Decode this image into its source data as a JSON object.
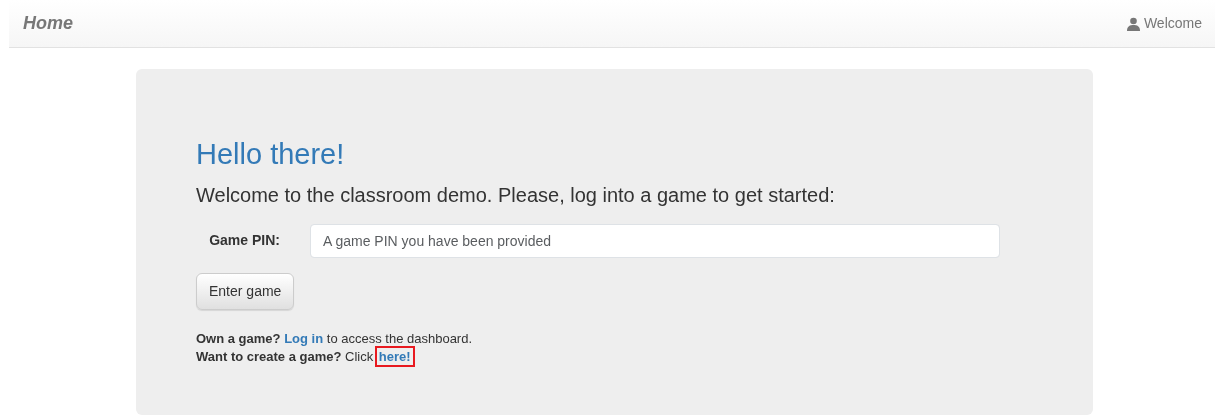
{
  "navbar": {
    "brand": "Home",
    "user_link": "Welcome"
  },
  "hero": {
    "title": "Hello there!",
    "lead": "Welcome to the classroom demo. Please, log into a game to get started:"
  },
  "form": {
    "label": "Game PIN:",
    "placeholder": "A game PIN you have been provided",
    "button": "Enter game"
  },
  "notes": [
    {
      "lead": "Own a game?",
      "link": "Log in",
      "after": "to access the dashboard.",
      "highlighted": false
    },
    {
      "lead": "Want to create a game?",
      "before": "Click",
      "link": "here!",
      "highlighted": true
    }
  ]
}
